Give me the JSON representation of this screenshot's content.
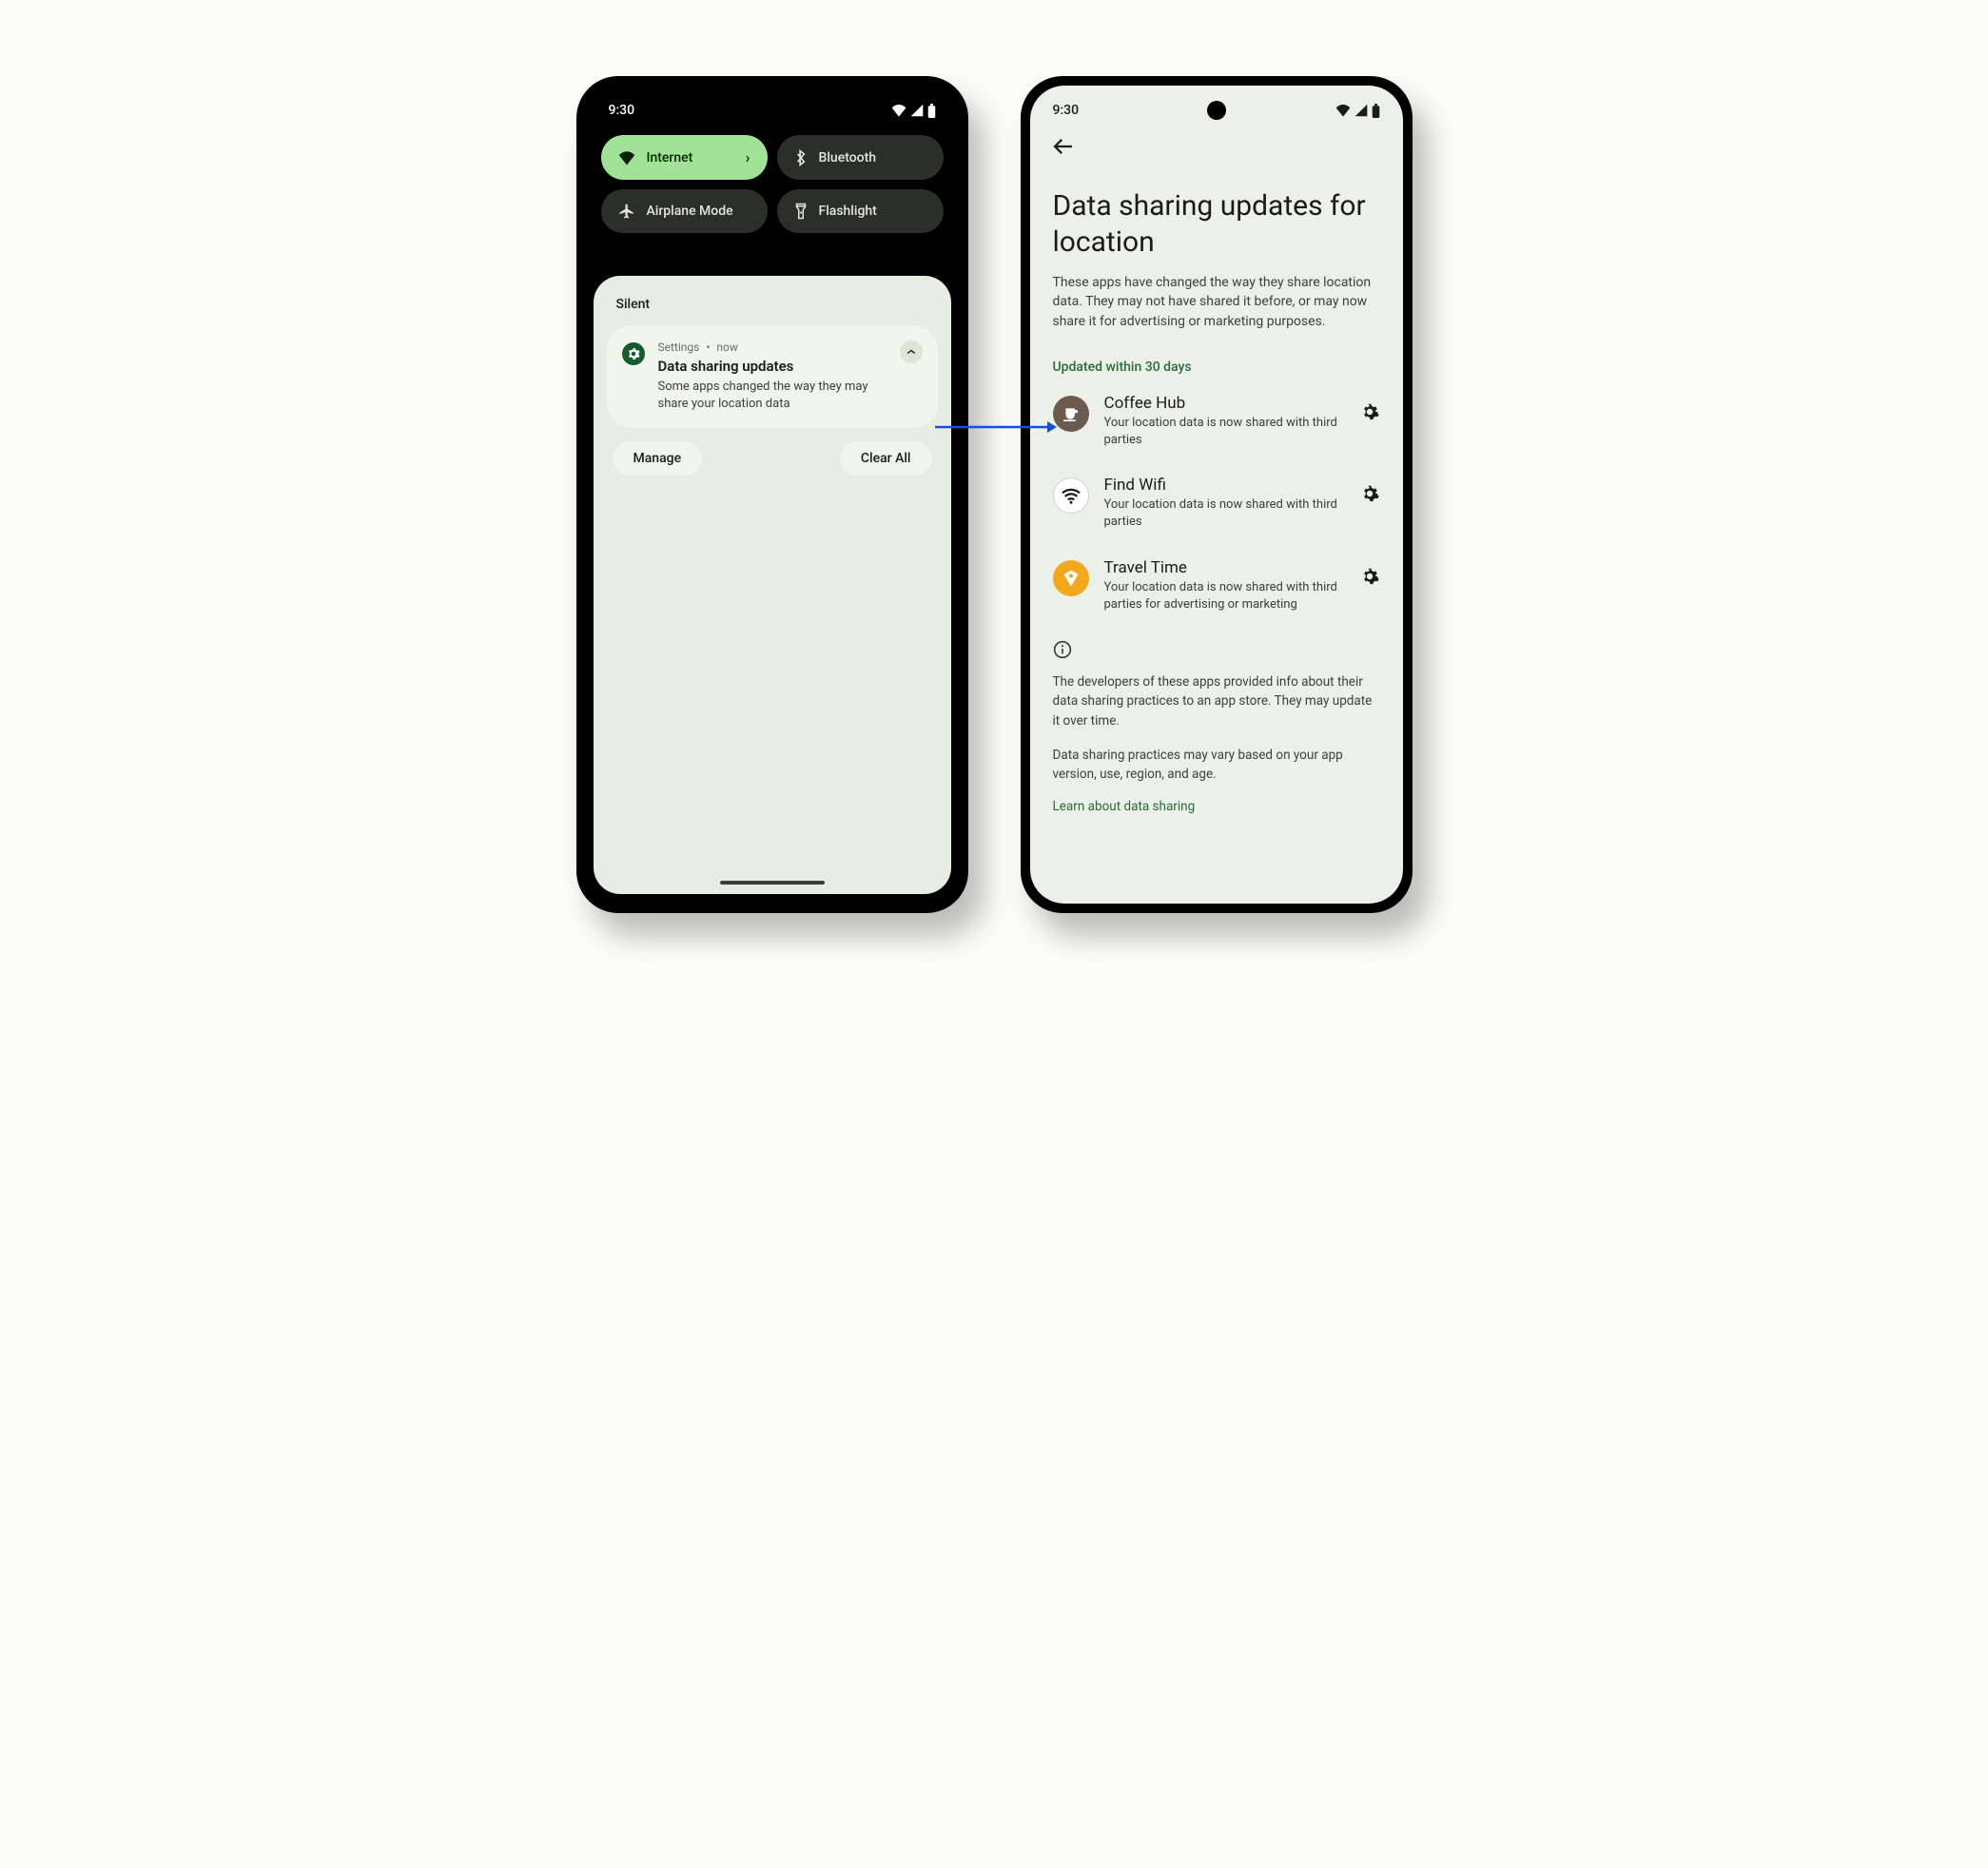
{
  "statusbar": {
    "time": "9:30"
  },
  "quick_settings": {
    "tiles": [
      {
        "label": "Internet",
        "icon": "wifi",
        "active": true,
        "chevron": true
      },
      {
        "label": "Bluetooth",
        "icon": "bluetooth",
        "active": false,
        "chevron": false
      },
      {
        "label": "Airplane Mode",
        "icon": "airplane",
        "active": false,
        "chevron": false
      },
      {
        "label": "Flashlight",
        "icon": "flashlight",
        "active": false,
        "chevron": false
      }
    ]
  },
  "shade": {
    "section_label": "Silent",
    "notification": {
      "app": "Settings",
      "separator": "•",
      "time": "now",
      "title": "Data sharing updates",
      "body": "Some apps changed the way they may share your location data"
    },
    "manage_label": "Manage",
    "clear_label": "Clear All"
  },
  "details": {
    "title": "Data sharing updates for location",
    "description": "These apps have changed the way they share location data. They may not have shared it before, or may now share it for advertising or marketing purposes.",
    "section_head": "Updated within 30 days",
    "apps": [
      {
        "name": "Coffee Hub",
        "desc": "Your location data is now shared with third parties",
        "icon_bg": "#6b5a4e",
        "icon": "coffee"
      },
      {
        "name": "Find Wifi",
        "desc": "Your location data is now shared with third parties",
        "icon_bg": "#ffffff",
        "icon": "wifi"
      },
      {
        "name": "Travel Time",
        "desc": "Your location data is now shared with third parties for advertising or marketing",
        "icon_bg": "#f3a71c",
        "icon": "tag"
      }
    ],
    "info1": "The developers of these apps provided info about their data sharing practices to an app store. They may update it over time.",
    "info2": "Data sharing practices may vary based on your app version, use, region, and age.",
    "learn_link": "Learn about data sharing"
  }
}
